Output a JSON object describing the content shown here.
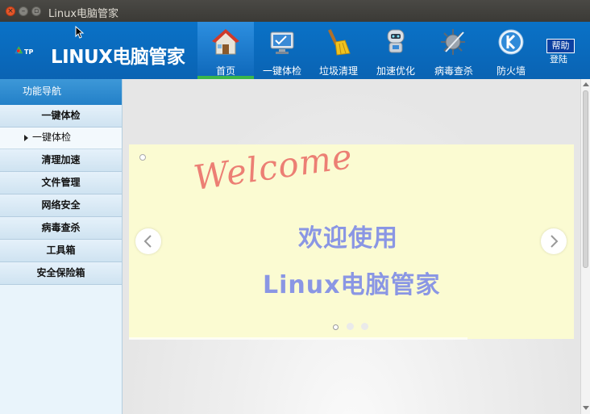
{
  "window": {
    "title": "Linux电脑管家"
  },
  "brand": {
    "badge": "TP",
    "name": "LINUX电脑管家"
  },
  "nav": [
    {
      "label": "首页",
      "icon": "home-icon",
      "active": true
    },
    {
      "label": "一键体检",
      "icon": "monitor-check-icon",
      "active": false
    },
    {
      "label": "垃圾清理",
      "icon": "broom-icon",
      "active": false
    },
    {
      "label": "加速优化",
      "icon": "robot-boost-icon",
      "active": false
    },
    {
      "label": "病毒查杀",
      "icon": "virus-scan-icon",
      "active": false
    },
    {
      "label": "防火墙",
      "icon": "firewall-shield-icon",
      "active": false
    }
  ],
  "header": {
    "help": "帮助",
    "login": "登陆"
  },
  "sidebar": {
    "title": "功能导航",
    "items": [
      {
        "label": "一键体检",
        "type": "section"
      },
      {
        "label": "一键体检",
        "type": "sub"
      },
      {
        "label": "清理加速",
        "type": "section"
      },
      {
        "label": "文件管理",
        "type": "section"
      },
      {
        "label": "网络安全",
        "type": "section"
      },
      {
        "label": "病毒查杀",
        "type": "section"
      },
      {
        "label": "工具箱",
        "type": "section"
      },
      {
        "label": "安全保险箱",
        "type": "section"
      }
    ]
  },
  "banner": {
    "welcome": "Welcome",
    "line1": "欢迎使用",
    "line2": "Linux电脑管家",
    "slides": 3,
    "active_slide": 1
  },
  "colors": {
    "header": "#0a6bbd",
    "active_underline": "#3ab54a",
    "banner_bg": "#fbfbd2",
    "welcome": "#ec7f74",
    "banner_text": "#8a96e4"
  }
}
